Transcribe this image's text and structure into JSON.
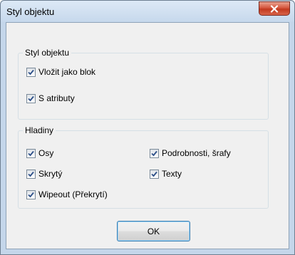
{
  "window": {
    "title": "Styl objektu",
    "close_icon": "close-icon"
  },
  "groups": {
    "style": {
      "title": "Styl objektu",
      "items": [
        {
          "label": "Vložit jako blok",
          "checked": true
        },
        {
          "label": "S atributy",
          "checked": true
        }
      ]
    },
    "layers": {
      "title": "Hladiny",
      "items": [
        {
          "label": "Osy",
          "checked": true
        },
        {
          "label": "Podrobnosti, šrafy",
          "checked": true
        },
        {
          "label": "Skrytý",
          "checked": true
        },
        {
          "label": "Texty",
          "checked": true
        },
        {
          "label": "Wipeout (Překrytí)",
          "checked": true
        }
      ]
    }
  },
  "buttons": {
    "ok_label": "OK"
  },
  "colors": {
    "check": "#2c4f88",
    "close_x": "#ffffff"
  }
}
